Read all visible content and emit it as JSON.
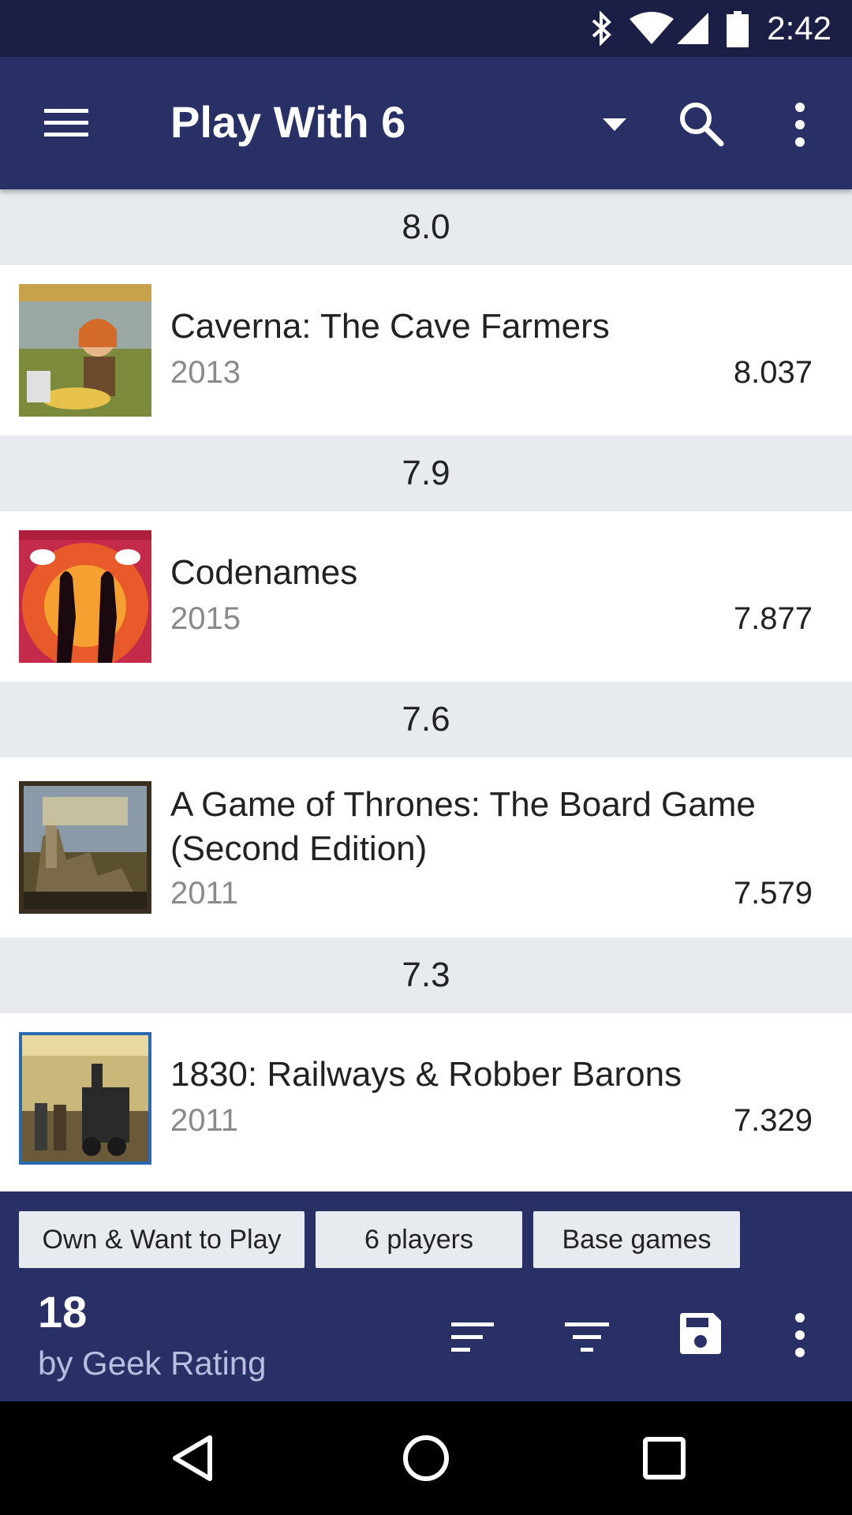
{
  "status_bar": {
    "time": "2:42",
    "icons": [
      "bluetooth-icon",
      "wifi-icon",
      "cell-signal-icon",
      "battery-icon"
    ]
  },
  "toolbar": {
    "title": "Play With 6",
    "icons": [
      "menu-icon",
      "dropdown-arrow-icon",
      "search-icon",
      "overflow-menu-icon"
    ]
  },
  "list": {
    "sections": [
      {
        "header": "8.0",
        "game": {
          "name": "Caverna: The Cave Farmers",
          "year": "2013",
          "rating": "8.037"
        }
      },
      {
        "header": "7.9",
        "game": {
          "name": "Codenames",
          "year": "2015",
          "rating": "7.877"
        }
      },
      {
        "header": "7.6",
        "game": {
          "name": "A Game of Thrones: The Board Game (Second Edition)",
          "year": "2011",
          "rating": "7.579"
        }
      },
      {
        "header": "7.3",
        "game": {
          "name": "1830: Railways & Robber Barons",
          "year": "2011",
          "rating": "7.329"
        }
      }
    ]
  },
  "bottom_bar": {
    "filters": [
      "Own & Want to Play",
      "6 players",
      "Base games"
    ],
    "count": "18",
    "sort_label": "by Geek Rating",
    "icons": [
      "sort-icon",
      "filter-icon",
      "save-icon",
      "overflow-menu-icon"
    ]
  },
  "colors": {
    "primary": "#283066",
    "status_bar": "#1b1e45",
    "section_header_bg": "#e7ebef",
    "secondary_text": "#8a8a8a"
  },
  "nav_bar": {
    "icons": [
      "back-icon",
      "home-icon",
      "recents-icon"
    ]
  }
}
